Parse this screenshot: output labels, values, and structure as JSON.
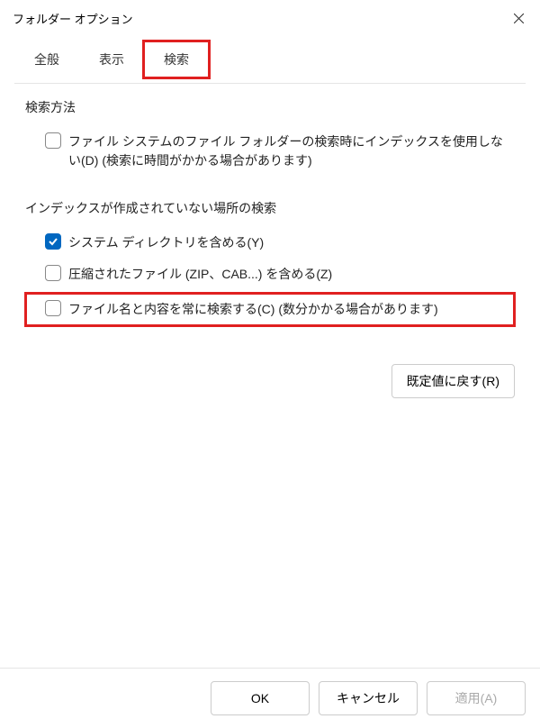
{
  "window": {
    "title": "フォルダー オプション"
  },
  "tabs": {
    "general": "全般",
    "view": "表示",
    "search": "検索"
  },
  "sections": {
    "searchMethod": {
      "title": "検索方法",
      "options": {
        "noIndex": {
          "label": "ファイル システムのファイル フォルダーの検索時にインデックスを使用しない(D) (検索に時間がかかる場合があります)",
          "checked": false
        }
      }
    },
    "unindexed": {
      "title": "インデックスが作成されていない場所の検索",
      "options": {
        "includeSystem": {
          "label": "システム ディレクトリを含める(Y)",
          "checked": true
        },
        "includeCompressed": {
          "label": "圧縮されたファイル (ZIP、CAB...) を含める(Z)",
          "checked": false
        },
        "alwaysSearchContents": {
          "label": "ファイル名と内容を常に検索する(C) (数分かかる場合があります)",
          "checked": false
        }
      }
    }
  },
  "buttons": {
    "restoreDefaults": "既定値に戻す(R)",
    "ok": "OK",
    "cancel": "キャンセル",
    "apply": "適用(A)"
  }
}
